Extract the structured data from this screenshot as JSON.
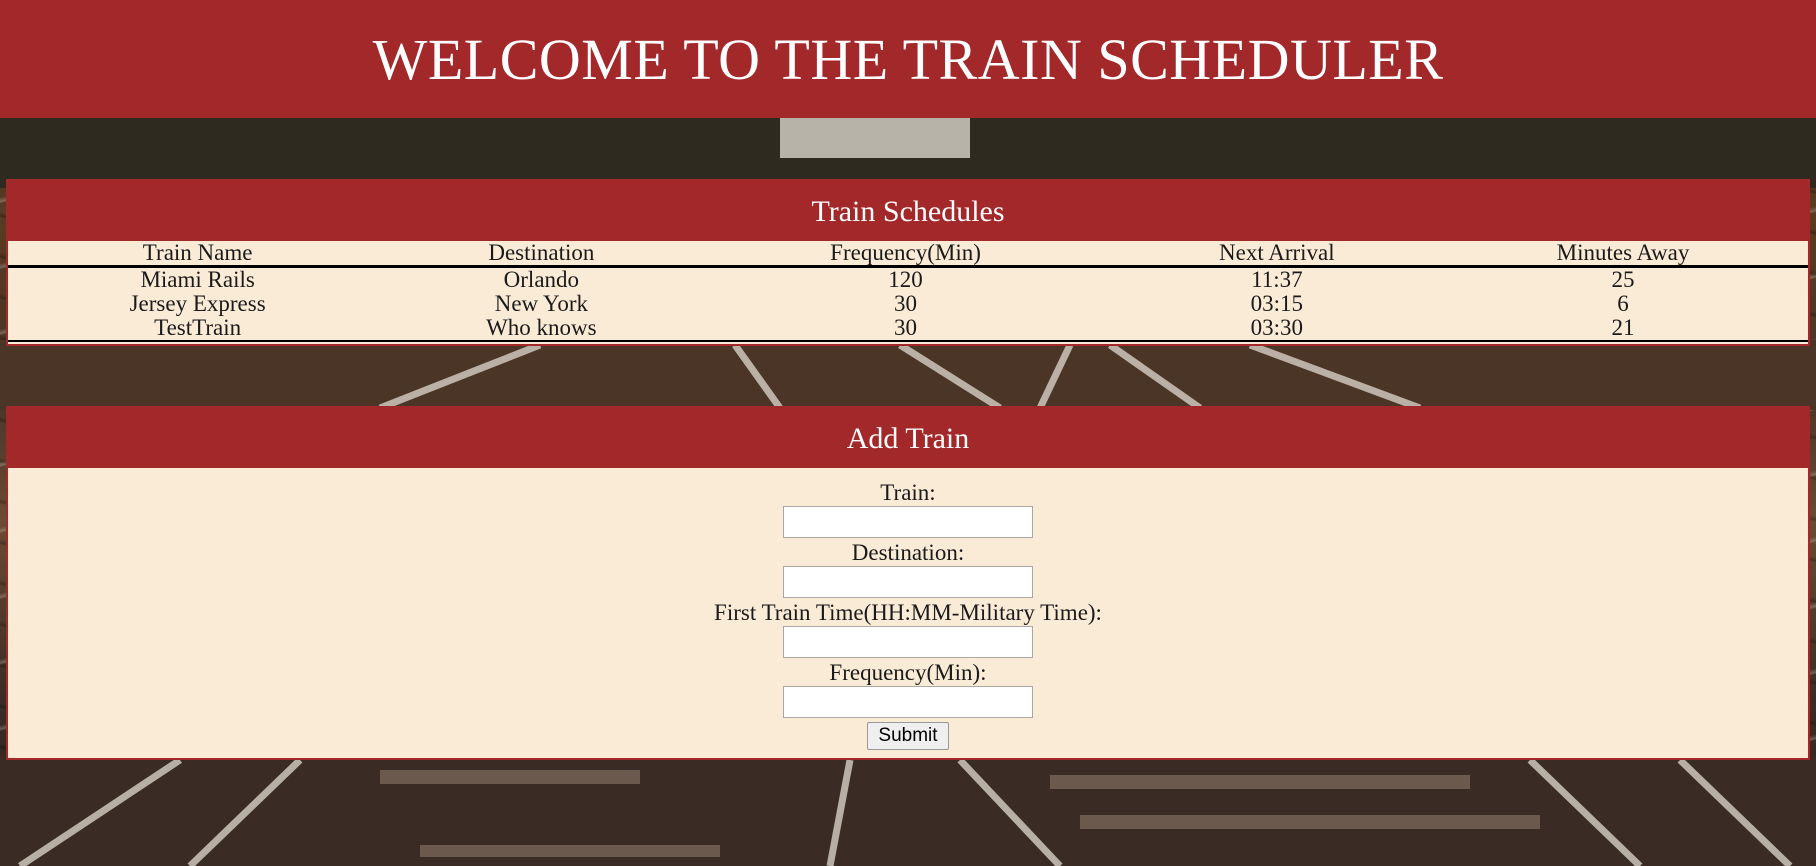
{
  "header": {
    "title": "WELCOME TO THE TRAIN SCHEDULER"
  },
  "schedules": {
    "heading": "Train Schedules",
    "columns": [
      "Train Name",
      "Destination",
      "Frequency(Min)",
      "Next Arrival",
      "Minutes Away"
    ],
    "rows": [
      [
        "Miami Rails",
        "Orlando",
        "120",
        "11:37",
        "25"
      ],
      [
        "Jersey Express",
        "New York",
        "30",
        "03:15",
        "6"
      ],
      [
        "TestTrain",
        "Who knows",
        "30",
        "03:30",
        "21"
      ]
    ]
  },
  "add_train": {
    "heading": "Add Train",
    "train_label": "Train:",
    "train_value": "",
    "destination_label": "Destination:",
    "destination_value": "",
    "first_time_label": "First Train Time(HH:MM-Military Time):",
    "first_time_value": "",
    "frequency_label": "Frequency(Min):",
    "frequency_value": "",
    "submit_label": "Submit"
  },
  "colors": {
    "brand_red": "#a3282a",
    "panel_bg": "#faebd7",
    "heading_text": "#ffffff"
  }
}
